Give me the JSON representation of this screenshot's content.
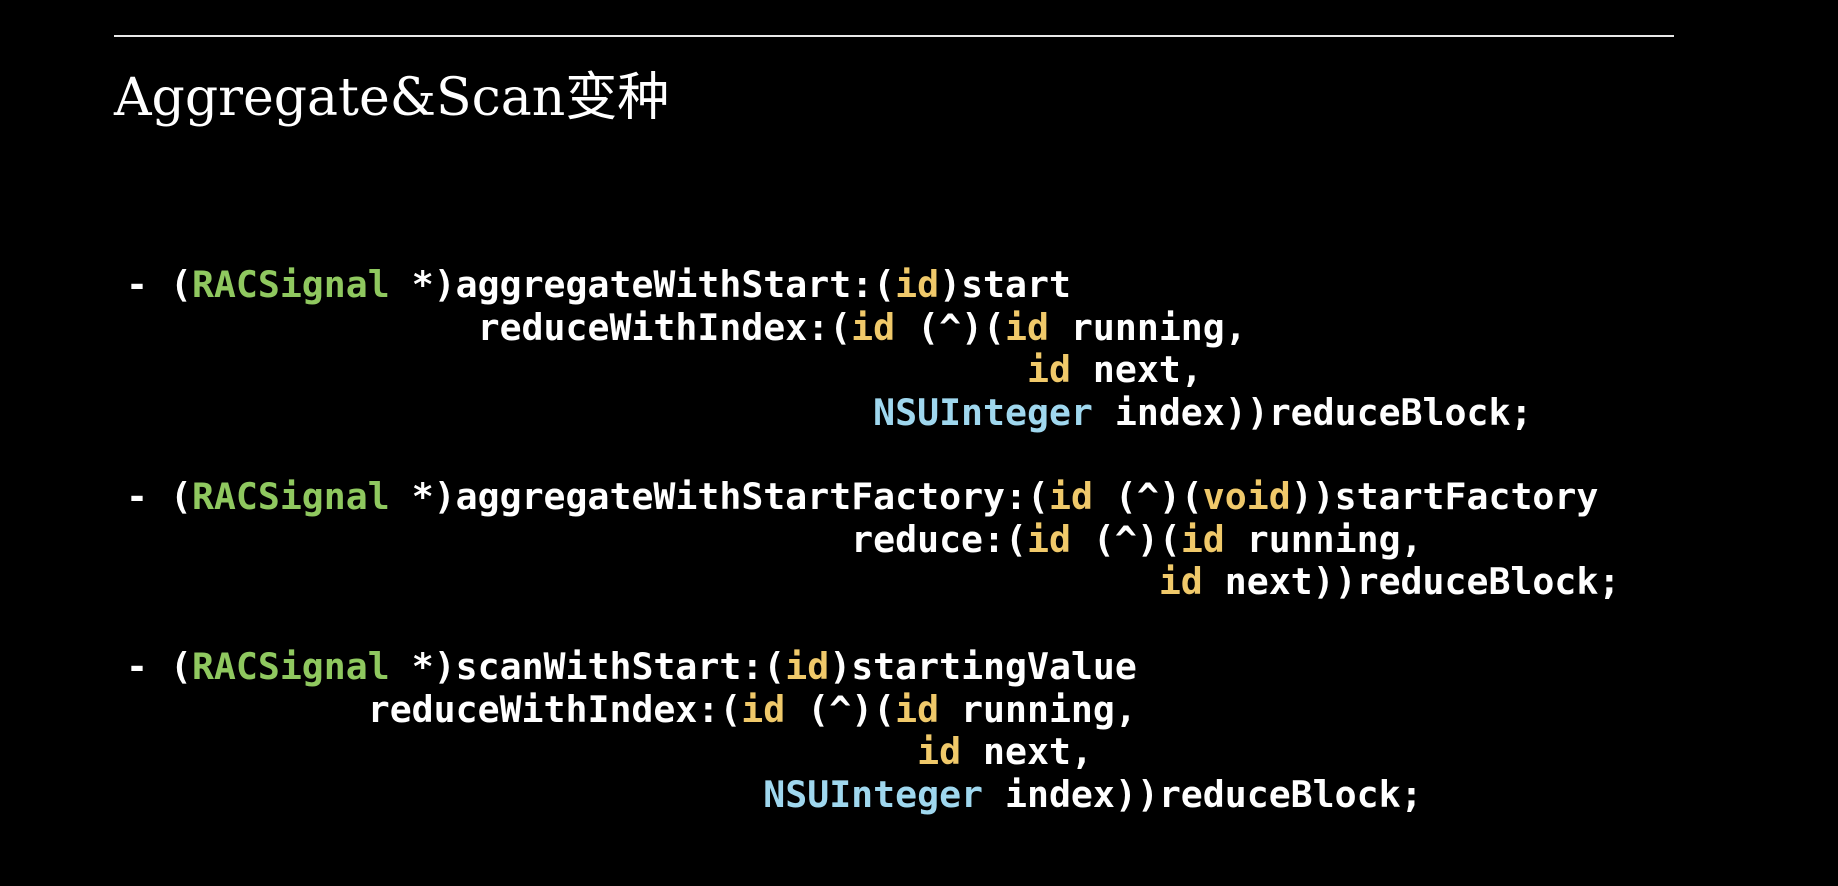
{
  "slide": {
    "title": "Aggregate&Scan变种"
  },
  "colors": {
    "background": "#000000",
    "text": "#ffffff",
    "keyword": "#f0c96a",
    "class_name": "#8fc85f",
    "type_name": "#9fd7ee"
  },
  "code_blocks": [
    {
      "name": "aggregateWithStart",
      "lines": [
        [
          {
            "t": "- (",
            "c": "plain"
          },
          {
            "t": "RACSignal",
            "c": "cls"
          },
          {
            "t": " *)aggregateWithStart:(",
            "c": "plain"
          },
          {
            "t": "id",
            "c": "kw"
          },
          {
            "t": ")start",
            "c": "plain"
          }
        ],
        [
          {
            "t": "                reduceWithIndex:(",
            "c": "plain"
          },
          {
            "t": "id",
            "c": "kw"
          },
          {
            "t": " (^)(",
            "c": "plain"
          },
          {
            "t": "id",
            "c": "kw"
          },
          {
            "t": " running,",
            "c": "plain"
          }
        ],
        [
          {
            "t": "                                         ",
            "c": "plain"
          },
          {
            "t": "id",
            "c": "kw"
          },
          {
            "t": " next,",
            "c": "plain"
          }
        ],
        [
          {
            "t": "                                  ",
            "c": "plain"
          },
          {
            "t": "NSUInteger",
            "c": "ty"
          },
          {
            "t": " index))reduceBlock;",
            "c": "plain"
          }
        ]
      ]
    },
    {
      "name": "aggregateWithStartFactory",
      "lines": [
        [
          {
            "t": "- (",
            "c": "plain"
          },
          {
            "t": "RACSignal",
            "c": "cls"
          },
          {
            "t": " *)aggregateWithStartFactory:(",
            "c": "plain"
          },
          {
            "t": "id",
            "c": "kw"
          },
          {
            "t": " (^)(",
            "c": "plain"
          },
          {
            "t": "void",
            "c": "kw"
          },
          {
            "t": "))startFactory",
            "c": "plain"
          }
        ],
        [
          {
            "t": "                                 reduce:(",
            "c": "plain"
          },
          {
            "t": "id",
            "c": "kw"
          },
          {
            "t": " (^)(",
            "c": "plain"
          },
          {
            "t": "id",
            "c": "kw"
          },
          {
            "t": " running,",
            "c": "plain"
          }
        ],
        [
          {
            "t": "                                               ",
            "c": "plain"
          },
          {
            "t": "id",
            "c": "kw"
          },
          {
            "t": " next))reduceBlock;",
            "c": "plain"
          }
        ]
      ]
    },
    {
      "name": "scanWithStart",
      "lines": [
        [
          {
            "t": "- (",
            "c": "plain"
          },
          {
            "t": "RACSignal",
            "c": "cls"
          },
          {
            "t": " *)scanWithStart:(",
            "c": "plain"
          },
          {
            "t": "id",
            "c": "kw"
          },
          {
            "t": ")startingValue",
            "c": "plain"
          }
        ],
        [
          {
            "t": "           reduceWithIndex:(",
            "c": "plain"
          },
          {
            "t": "id",
            "c": "kw"
          },
          {
            "t": " (^)(",
            "c": "plain"
          },
          {
            "t": "id",
            "c": "kw"
          },
          {
            "t": " running,",
            "c": "plain"
          }
        ],
        [
          {
            "t": "                                    ",
            "c": "plain"
          },
          {
            "t": "id",
            "c": "kw"
          },
          {
            "t": " next,",
            "c": "plain"
          }
        ],
        [
          {
            "t": "                             ",
            "c": "plain"
          },
          {
            "t": "NSUInteger",
            "c": "ty"
          },
          {
            "t": " index))reduceBlock;",
            "c": "plain"
          }
        ]
      ]
    }
  ]
}
